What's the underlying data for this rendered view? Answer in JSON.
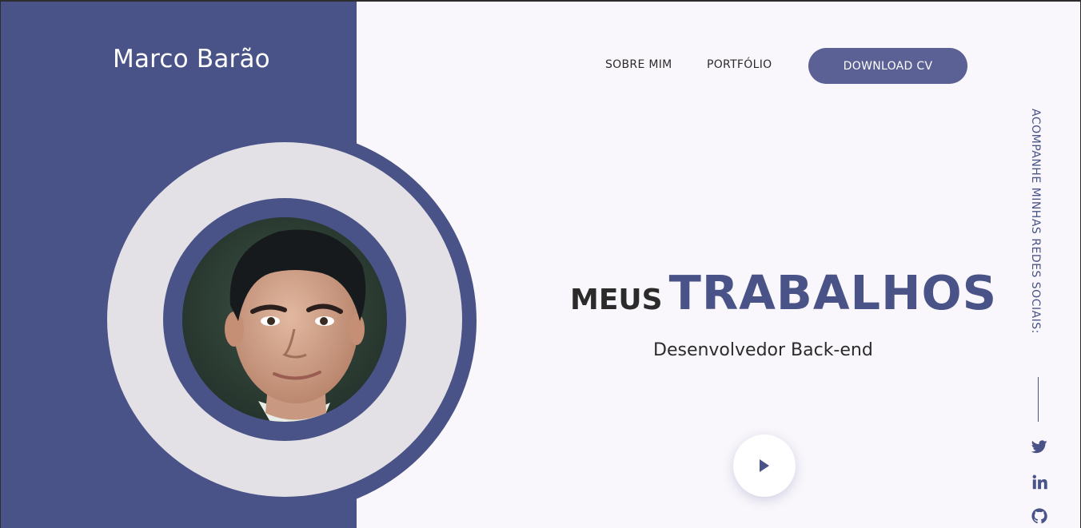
{
  "brand": {
    "name": "Marco Barão"
  },
  "nav": {
    "items": [
      {
        "label": "SOBRE MIM"
      },
      {
        "label": "PORTFÓLIO"
      }
    ],
    "download_label": "DOWNLOAD CV"
  },
  "hero": {
    "headline_small": "MEUS",
    "headline_big": "TRABALHOS",
    "subtitle": "Desenvolvedor Back-end"
  },
  "social": {
    "label": "ACOMPANHE MINHAS REDES SOCIAIS:",
    "icons": [
      "twitter-icon",
      "linkedin-icon",
      "github-icon"
    ]
  },
  "colors": {
    "primary": "#495387",
    "button": "#5b6194",
    "background": "#f9f7fb",
    "ring_light": "#e3e1e6",
    "text": "#2b2b2b"
  },
  "icons": {
    "play": "play-icon"
  }
}
